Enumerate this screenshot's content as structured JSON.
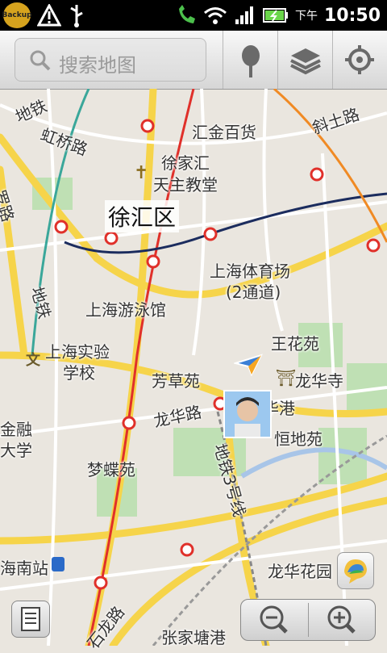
{
  "status_bar": {
    "backup_label": "Backup",
    "ampm": "下午",
    "time": "10:50",
    "icons": [
      "backup-icon",
      "warning-icon",
      "usb-icon",
      "phone-icon",
      "wifi-icon",
      "signal-icon",
      "battery-icon"
    ]
  },
  "search": {
    "placeholder": "搜索地图"
  },
  "toolbar": {
    "buttons": [
      "places-icon",
      "layers-icon",
      "my-location-icon"
    ]
  },
  "map": {
    "district": "徐汇区",
    "places": [
      {
        "id": "huijin",
        "text": "汇金百货"
      },
      {
        "id": "cathedral1",
        "text": "徐家汇"
      },
      {
        "id": "cathedral2",
        "text": "天主教堂"
      },
      {
        "id": "stadium1",
        "text": "上海体育场"
      },
      {
        "id": "stadium2",
        "text": "(2通道)"
      },
      {
        "id": "swimming",
        "text": "上海游泳馆"
      },
      {
        "id": "school1",
        "text": "上海实验"
      },
      {
        "id": "school2",
        "text": "学校"
      },
      {
        "id": "fangcao",
        "text": "芳草苑"
      },
      {
        "id": "longhuasi",
        "text": "龙华寺"
      },
      {
        "id": "longhuagang",
        "text": "龙华港"
      },
      {
        "id": "hengdi",
        "text": "恒地苑"
      },
      {
        "id": "jinrong1",
        "text": "金融"
      },
      {
        "id": "jinrong2",
        "text": "大学"
      },
      {
        "id": "mengdie",
        "text": "梦蝶苑"
      },
      {
        "id": "longhuahuayuan",
        "text": "龙华花园"
      },
      {
        "id": "zhangjiatang",
        "text": "张家塘港"
      },
      {
        "id": "shanghaisouth",
        "text": "海南站"
      },
      {
        "id": "wanghuayuan",
        "text": "王花苑"
      }
    ],
    "roads": [
      {
        "id": "hongqiao",
        "text": "虹桥路"
      },
      {
        "id": "xietu",
        "text": "斜土路"
      },
      {
        "id": "longhua_rd",
        "text": "龙华路"
      },
      {
        "id": "line3",
        "text": "地铁3号线"
      },
      {
        "id": "line_left",
        "text": "地铁"
      },
      {
        "id": "line_top",
        "text": "地铁"
      },
      {
        "id": "road_left",
        "text": "罗路"
      },
      {
        "id": "shilong",
        "text": "石龙路"
      }
    ],
    "colors": {
      "land": "#eae6df",
      "major_road": "#f6d44a",
      "metro_red": "#e0302a",
      "metro_dark": "#1b2c5e",
      "metro_orange": "#f08a24",
      "metro_teal": "#3aa79a",
      "green": "#bfe0b4"
    }
  },
  "controls": {
    "menu": "menu-icon",
    "zoom_out": "zoom-out-icon",
    "zoom_in": "zoom-in-icon",
    "buzz": "buzz-icon"
  }
}
